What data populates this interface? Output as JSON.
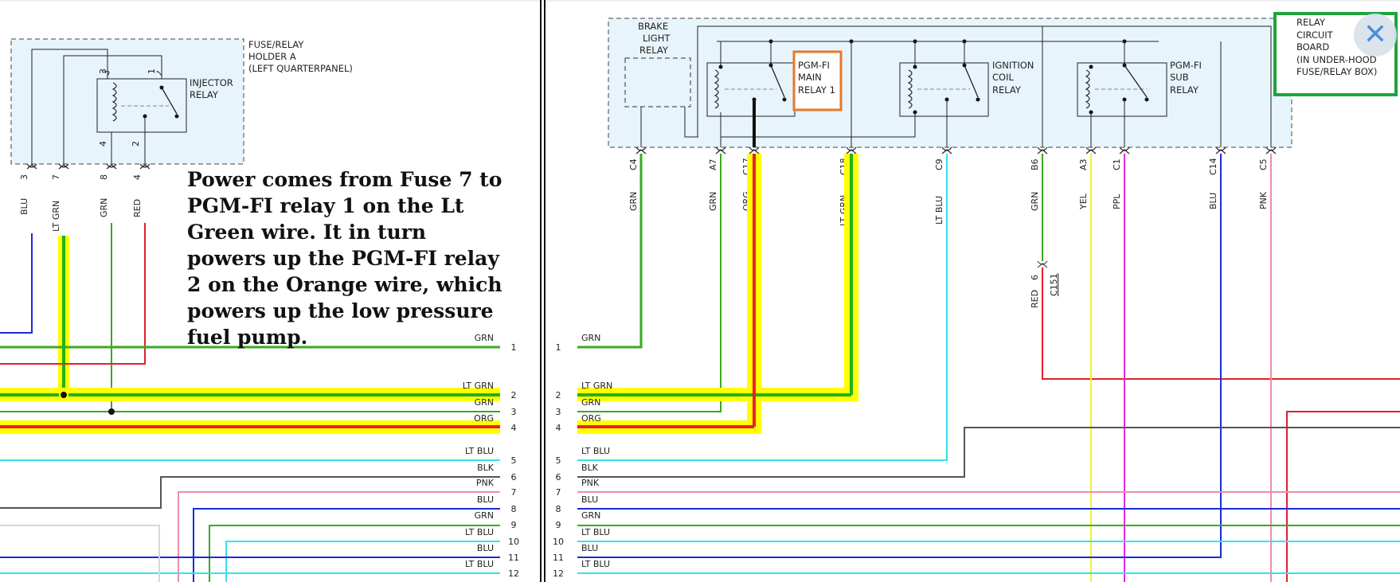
{
  "left_panel": {
    "holder_label": [
      "FUSE/RELAY",
      "HOLDER A",
      "(LEFT QUARTERPANEL)"
    ],
    "relay_label": [
      "INJECTOR",
      "RELAY"
    ],
    "top_pins": [
      "3",
      "1"
    ],
    "bottom_pins": [
      "4",
      "2"
    ],
    "connectors": [
      {
        "pin": "3",
        "color": "BLU"
      },
      {
        "pin": "7",
        "color": "LT GRN"
      },
      {
        "pin": "8",
        "color": "GRN"
      },
      {
        "pin": "4",
        "color": "RED"
      }
    ]
  },
  "annotation": "Power comes from Fuse 7 to PGM-FI relay 1 on the Lt Green wire. It in turn powers up the PGM-FI relay 2 on the Orange wire, which powers up the low pressure fuel pump.",
  "right_panel": {
    "brake_relay_label": [
      "BRAKE",
      "LIGHT",
      "RELAY"
    ],
    "main_relay_label": [
      "PGM-FI",
      "MAIN",
      "RELAY 1"
    ],
    "ignition_relay_label": [
      "IGNITION",
      "COIL",
      "RELAY"
    ],
    "sub_relay_label": [
      "PGM-FI",
      "SUB",
      "RELAY"
    ],
    "board_label": [
      "RELAY",
      "CIRCUIT",
      "BOARD",
      "(IN UNDER-HOOD",
      "FUSE/RELAY BOX)"
    ],
    "connectors": [
      {
        "pin": "C4",
        "color": "GRN"
      },
      {
        "pin": "A7",
        "color": "GRN"
      },
      {
        "pin": "C17",
        "color": "ORG"
      },
      {
        "pin": "C18",
        "color": "LT GRN"
      },
      {
        "pin": "C9",
        "color": "LT BLU"
      },
      {
        "pin": "B6",
        "color": "GRN"
      },
      {
        "pin": "A3",
        "color": "YEL"
      },
      {
        "pin": "C1",
        "color": "PPL"
      },
      {
        "pin": "C14",
        "color": "BLU"
      },
      {
        "pin": "C5",
        "color": "PNK"
      }
    ],
    "junction": {
      "pin": "6",
      "connector": "C151",
      "color": "RED"
    }
  },
  "harness_rows": [
    {
      "num": "1",
      "left": "GRN",
      "right": "GRN"
    },
    {
      "num": "2",
      "left": "LT GRN",
      "right": "LT GRN"
    },
    {
      "num": "3",
      "left": "GRN",
      "right": "GRN"
    },
    {
      "num": "4",
      "left": "ORG",
      "right": "ORG"
    },
    {
      "num": "5",
      "left": "LT BLU",
      "right": "LT BLU"
    },
    {
      "num": "6",
      "left": "BLK",
      "right": "BLK"
    },
    {
      "num": "7",
      "left": "PNK",
      "right": "PNK"
    },
    {
      "num": "8",
      "left": "BLU",
      "right": "BLU"
    },
    {
      "num": "9",
      "left": "GRN",
      "right": "GRN"
    },
    {
      "num": "10",
      "left": "LT BLU",
      "right": "LT BLU"
    },
    {
      "num": "11",
      "left": "BLU",
      "right": "BLU"
    },
    {
      "num": "12",
      "left": "LT BLU",
      "right": "LT BLU"
    }
  ],
  "close_glyph": "✕",
  "colors": {
    "highlight_yellow": "#ffff00",
    "grn": "#3aaa1f",
    "lt_grn": "#1db31d",
    "red": "#e0202b",
    "org": "#e8202b",
    "blu": "#1b2bd6",
    "lt_blu": "#31e4ee",
    "blk": "#555555",
    "pnk": "#f08ca8",
    "yel": "#f2f22e",
    "ppl": "#e028e0",
    "box_fill": "#e7f4fb",
    "orange_box": "#e6782a",
    "green_box": "#1fa33e"
  }
}
